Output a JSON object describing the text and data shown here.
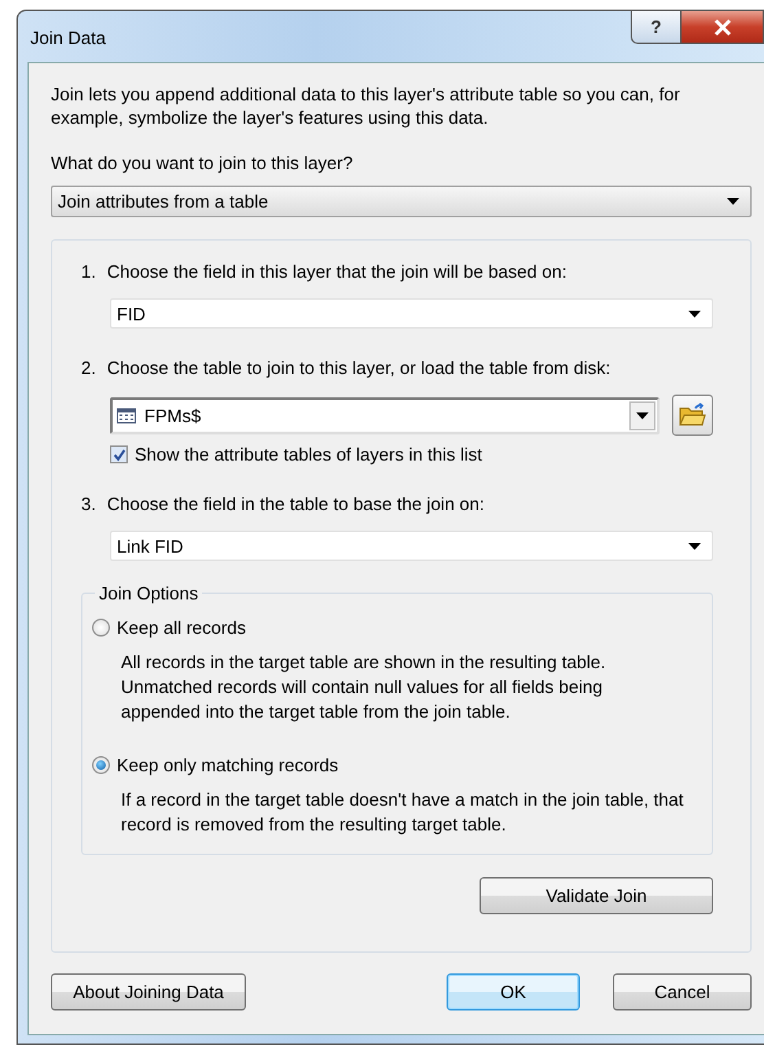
{
  "window": {
    "title": "Join Data",
    "help": "?"
  },
  "intro": "Join lets you append additional data to this layer's attribute table so you can, for example, symbolize the layer's features using this data.",
  "join_question": "What do you want to join to this layer?",
  "join_type": {
    "value": "Join attributes from a table"
  },
  "steps": [
    {
      "number": "1.",
      "label": "Choose the field in this layer that the join will be based on:",
      "value": "FID",
      "kind": "field"
    },
    {
      "number": "2.",
      "label": "Choose the table to join to this layer, or load the table from disk:",
      "value": "FPMs$",
      "kind": "table",
      "checkbox": {
        "label": "Show the attribute tables of layers in this list",
        "checked": true
      }
    },
    {
      "number": "3.",
      "label": "Choose the field in the table to base the join on:",
      "value": "Link FID",
      "kind": "field"
    }
  ],
  "join_options": {
    "title": "Join Options",
    "options": [
      {
        "label": "Keep all records",
        "description": "All records in the target table are shown in the resulting table. Unmatched records will contain null values for all fields being appended into the target table from the join table.",
        "selected": false
      },
      {
        "label": "Keep only matching records",
        "description": "If a record in the target table doesn't have a match in the join table, that record is removed from the resulting target table.",
        "selected": true
      }
    ]
  },
  "validate_button": "Validate Join",
  "footer_buttons": [
    {
      "label": "About Joining Data",
      "default": false
    },
    {
      "label": "OK",
      "default": true
    },
    {
      "label": "Cancel",
      "default": false
    }
  ]
}
